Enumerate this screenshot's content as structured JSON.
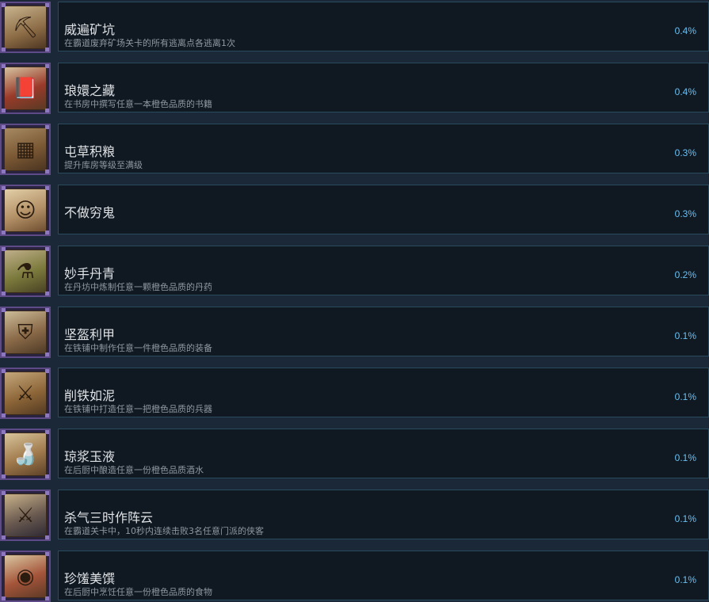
{
  "achievements": [
    {
      "title": "威遍矿坑",
      "desc": "在霸道废弃矿场关卡的所有逃离点各逃离1次",
      "percent": "0.4%",
      "icon": "abandoned-mine-icon",
      "icon_glyph": "⛏"
    },
    {
      "title": "琅嬛之藏",
      "desc": "在书房中撰写任意一本橙色品质的书籍",
      "percent": "0.4%",
      "icon": "book-icon",
      "icon_glyph": "📕"
    },
    {
      "title": "屯草积粮",
      "desc": "提升库房等级至满级",
      "percent": "0.3%",
      "icon": "storehouse-icon",
      "icon_glyph": "▦"
    },
    {
      "title": "不做穷鬼",
      "desc": "",
      "percent": "0.3%",
      "icon": "merchant-icon",
      "icon_glyph": "☺"
    },
    {
      "title": "妙手丹青",
      "desc": "在丹坊中炼制任意一颗橙色品质的丹药",
      "percent": "0.2%",
      "icon": "alchemy-cauldron-icon",
      "icon_glyph": "⚗"
    },
    {
      "title": "坚盔利甲",
      "desc": "在铁铺中制作任意一件橙色品质的装备",
      "percent": "0.1%",
      "icon": "armor-icon",
      "icon_glyph": "⛨"
    },
    {
      "title": "削铁如泥",
      "desc": "在铁铺中打造任意一把橙色品质的兵器",
      "percent": "0.1%",
      "icon": "weapon-rack-icon",
      "icon_glyph": "⚔"
    },
    {
      "title": "琼浆玉液",
      "desc": "在后厨中酿造任意一份橙色品质酒水",
      "percent": "0.1%",
      "icon": "wine-bottle-icon",
      "icon_glyph": "🍶"
    },
    {
      "title": "杀气三时作阵云",
      "desc": "在霸道关卡中，10秒内连续击败3名任意门派的侠客",
      "percent": "0.1%",
      "icon": "warrior-icon",
      "icon_glyph": "⚔"
    },
    {
      "title": "珍馐美馔",
      "desc": "在后厨中烹饪任意一份橙色品质的食物",
      "percent": "0.1%",
      "icon": "food-plate-icon",
      "icon_glyph": "◉"
    }
  ]
}
